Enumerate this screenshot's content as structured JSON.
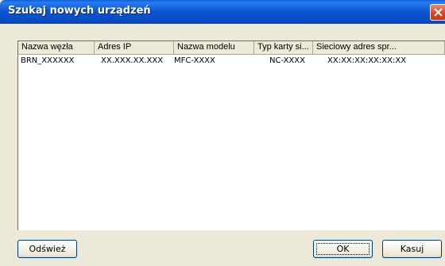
{
  "window": {
    "title": "Szukaj nowych urządzeń"
  },
  "table": {
    "columns": [
      "Nazwa węzła",
      "Adres IP",
      "Nazwa modelu",
      "Typ karty si...",
      "Sieciowy adres spr..."
    ],
    "rows": [
      [
        "BRN_XXXXXX",
        "XX.XXX.XX.XXX",
        "MFC-XXXX",
        "NC-XXXX",
        "XX:XX:XX:XX:XX:XX"
      ]
    ]
  },
  "buttons": {
    "refresh": "Odśwież",
    "ok": "OK",
    "cancel": "Kasuj"
  }
}
